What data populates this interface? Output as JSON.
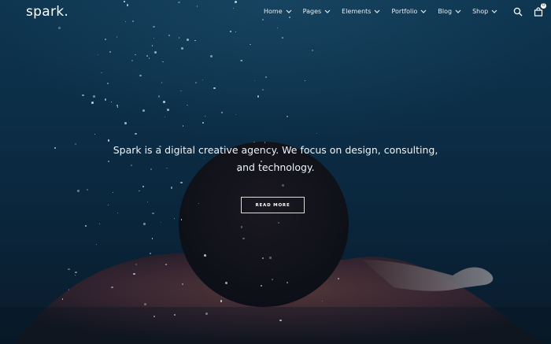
{
  "brand": {
    "logo_text": "spark."
  },
  "nav": {
    "items": [
      {
        "label": "Home"
      },
      {
        "label": "Pages"
      },
      {
        "label": "Elements"
      },
      {
        "label": "Portfolio"
      },
      {
        "label": "Blog"
      },
      {
        "label": "Shop"
      }
    ],
    "search_icon": "search-icon",
    "cart_icon": "shopping-bag-icon",
    "cart_count": "0"
  },
  "hero": {
    "tagline_line1": "Spark is a digital creative agency. We focus on design, consulting,",
    "tagline_line2": "and technology.",
    "cta_label": "READ MORE",
    "background": "underwater swimmer photo"
  },
  "colors": {
    "background_top": "#0e3550",
    "background_bottom": "#091b2b",
    "text": "#ffffff"
  }
}
